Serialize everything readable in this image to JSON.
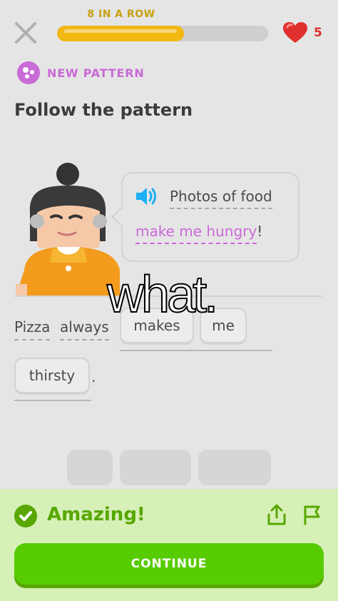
{
  "header": {
    "streak_label": "8 IN A ROW",
    "progress_fraction": 0.6,
    "hearts": "5"
  },
  "lesson": {
    "badge_label": "NEW PATTERN",
    "title": "Follow the pattern"
  },
  "bubble": {
    "line1": "Photos of food",
    "line2_highlight": "make me hungry",
    "line2_end": "!"
  },
  "sentence": {
    "prefix_words": [
      "Pizza",
      "always"
    ],
    "placed_tiles": [
      "makes",
      "me",
      "thirsty"
    ],
    "period": "."
  },
  "word_bank": {
    "slots_remaining": 3
  },
  "overlay_caption": "what.",
  "feedback": {
    "message": "Amazing!",
    "continue_label": "CONTINUE"
  },
  "colors": {
    "progress": "#f2b711",
    "pattern": "#c96ad6",
    "success": "#58a700",
    "button": "#58cc02",
    "heart": "#e0302e"
  }
}
